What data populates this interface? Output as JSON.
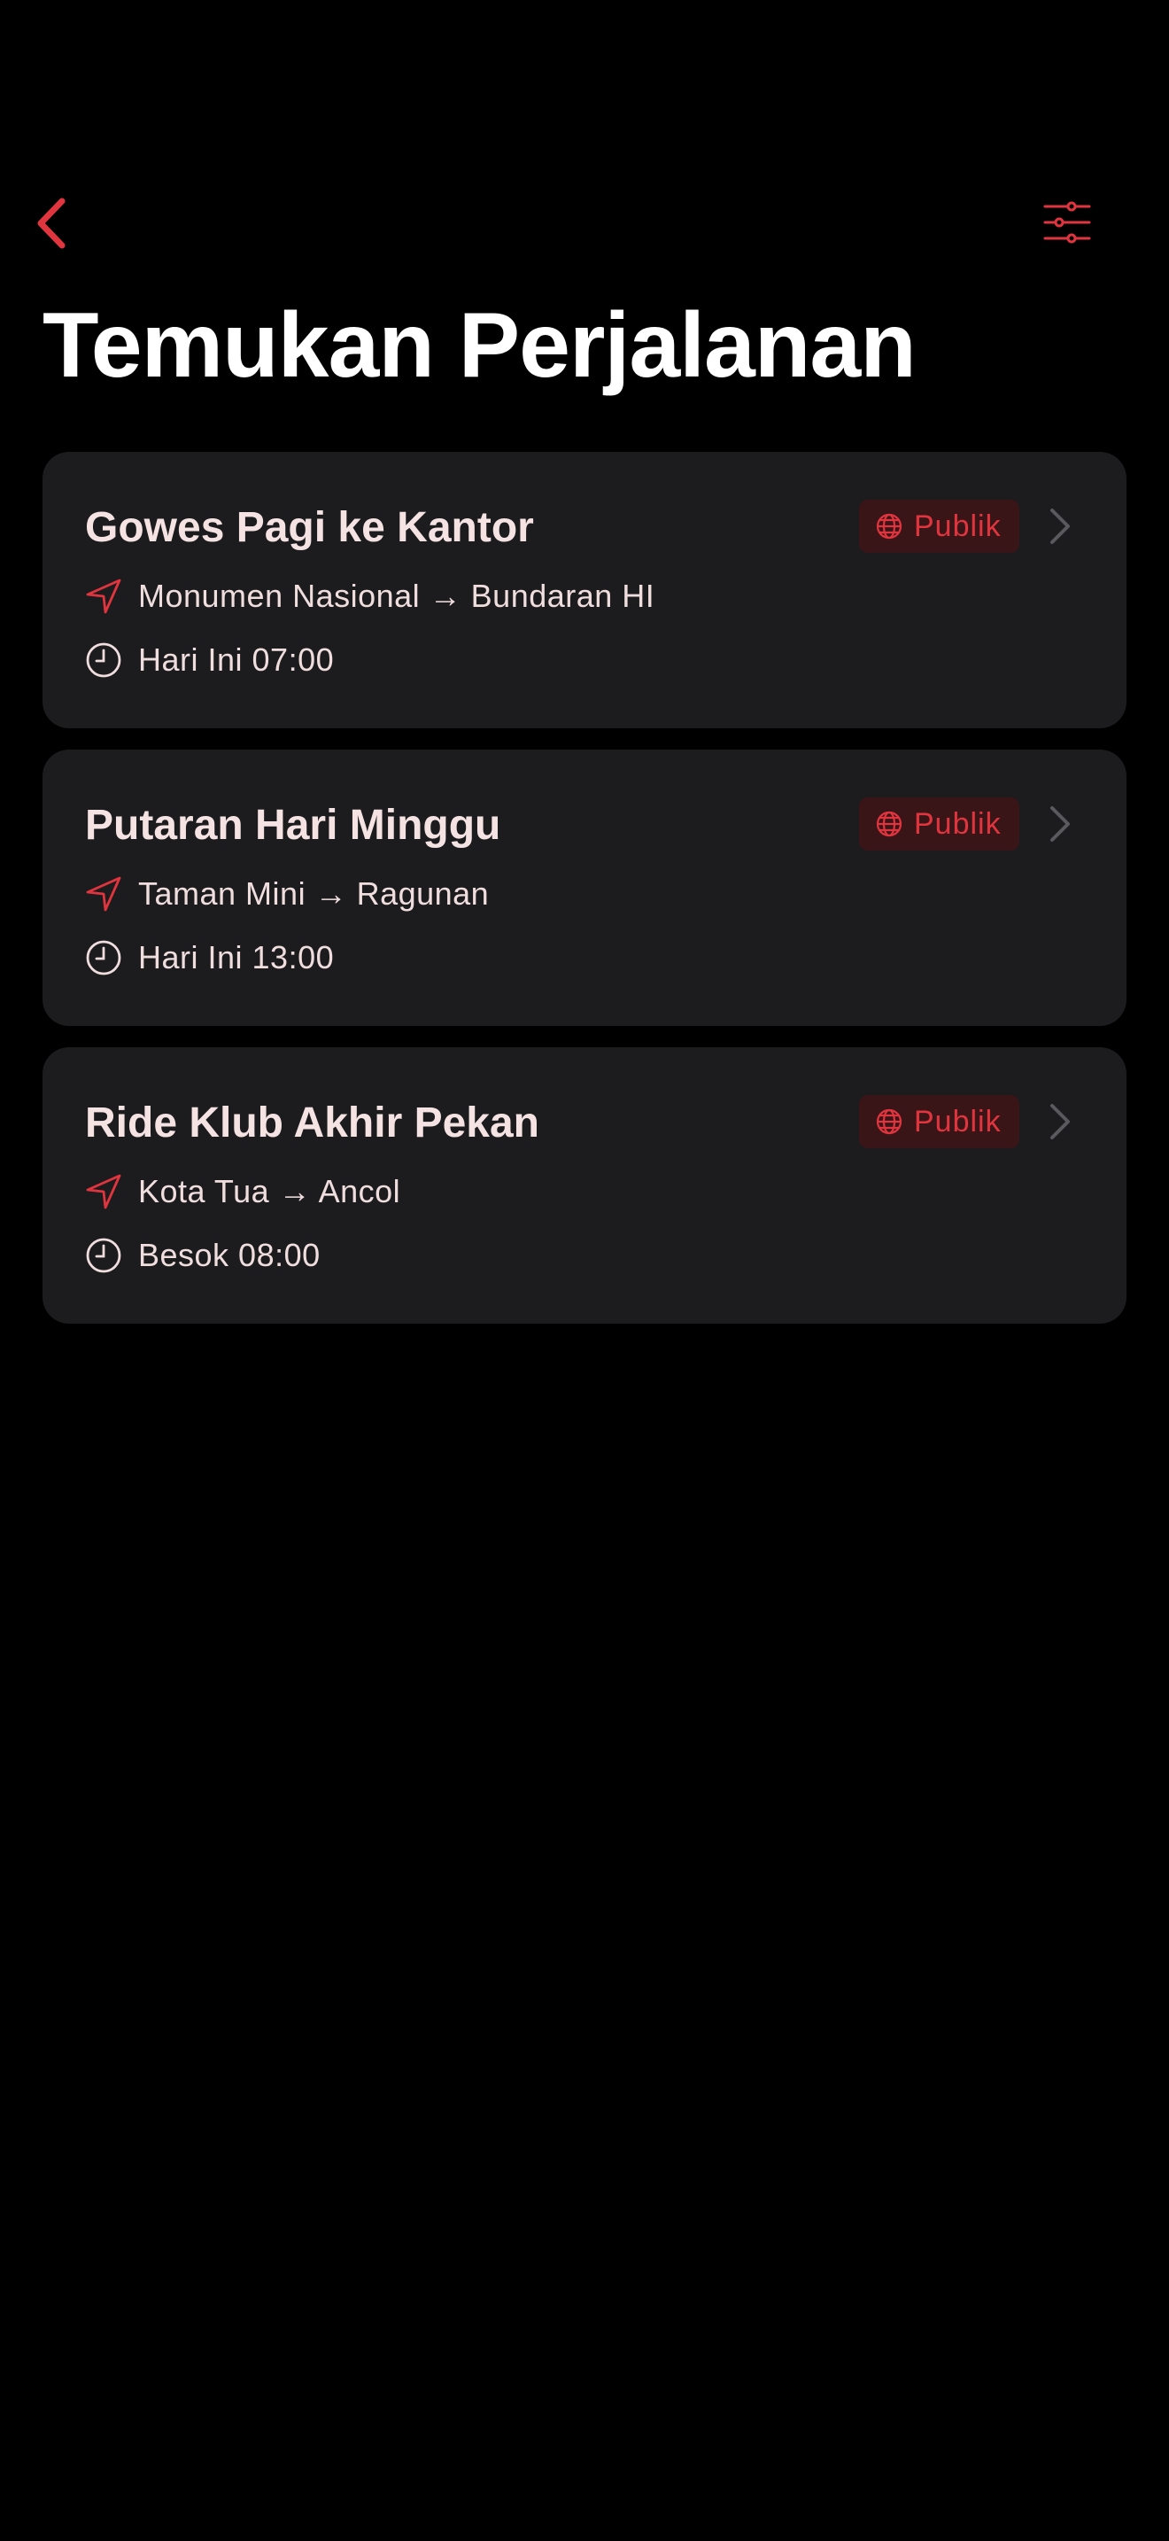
{
  "header": {
    "title": "Temukan Perjalanan",
    "back_icon": "chevron-left-icon",
    "filter_icon": "sliders-icon"
  },
  "colors": {
    "background": "#000000",
    "card": "#1c1c1e",
    "accent": "#e0353e",
    "badge_bg": "#3a1517",
    "text_primary": "#f5e3e3",
    "chevron": "#5a5a5e"
  },
  "rides": [
    {
      "title": "Gowes Pagi ke Kantor",
      "badge": "Publik",
      "route": "Monumen Nasional → Bundaran HI",
      "time": "Hari Ini 07:00"
    },
    {
      "title": "Putaran Hari Minggu",
      "badge": "Publik",
      "route": "Taman Mini → Ragunan",
      "time": "Hari Ini 13:00"
    },
    {
      "title": "Ride Klub Akhir Pekan",
      "badge": "Publik",
      "route": "Kota Tua → Ancol",
      "time": "Besok 08:00"
    }
  ]
}
